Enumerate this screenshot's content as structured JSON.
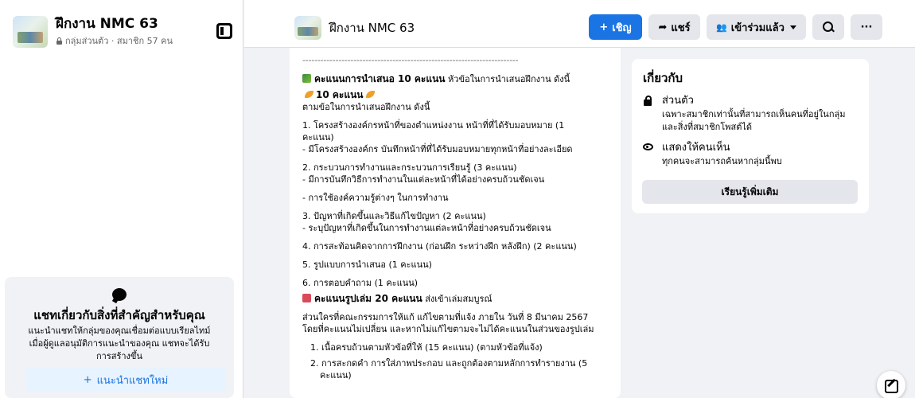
{
  "sidebar": {
    "group_name": "ฝึกงาน NMC 63",
    "group_meta": "กลุ่มส่วนตัว · สมาชิก 57 คน",
    "chat_promo": {
      "title": "แชทเกี่ยวกับสิ่งที่สำคัญสำหรับคุณ",
      "desc_line1": "แนะนำแชทให้กลุ่มของคุณเชื่อมต่อแบบเรียลไทม์",
      "desc_line2": "เมื่อผู้ดูแลอนุมัติการแนะนำของคุณ แชทจะได้รับ",
      "desc_line3": "การสร้างขึ้น",
      "button": "แนะนำแชทใหม่"
    }
  },
  "topbar": {
    "group_name": "ฝึกงาน NMC 63",
    "invite": "เชิญ",
    "share": "แชร์",
    "joined": "เข้าร่วมแล้ว",
    "more": "···"
  },
  "post": {
    "dashes": "------------------------------------------------------------------------",
    "l1_bold": "คะแนนการนำเสนอ 10 คะแนน",
    "l1_rest": " หัวข้อในการนำเสนอฝึกงาน ดังนี้",
    "l2_bold": "10 คะแนน",
    "l3": "ตามข้อในการนำเสนอฝึกงาน ดังนี้",
    "i1a": "1. โครงสร้างองค์กรหน้าที่ของตำแหน่งงาน หน้าที่ที่ได้รับมอบหมาย (1",
    "i1b": "คะแนน)",
    "i1c": "- มีโครงสร้างองค์กร บันทึกหน้าที่ที่ได้รับมอบหมายทุกหน้าที่อย่างละเอียด",
    "i2a": "2. กระบวนการทำงานและกระบวนการเรียนรู้ (3 คะแนน)",
    "i2b": "- มีการบันทึกวิธีการทำงานในแต่ละหน้าที่ได้อย่างครบถ้วนชัดเจน",
    "i2c": "- การใช้องค์ความรู้ต่างๆ ในการทำงาน",
    "i3a": "3. ปัญหาที่เกิดขึ้นและวิธีแก้ไขปัญหา (2 คะแนน)",
    "i3b": "- ระบุปัญหาที่เกิดขึ้นในการทำงานแต่ละหน้าที่อย่างครบถ้วนชัดเจน",
    "i4": "4. การสะท้อนคิดจากการฝึกงาน (ก่อนฝึก ระหว่างฝึก หลังฝึก) (2 คะแนน)",
    "i5": "5. รูปแบบการนำเสนอ (1 คะแนน)",
    "i6": "6. การตอบคำถาม (1 คะแนน)",
    "r_bold": "คะแนนรูปเล่ม 20 คะแนน",
    "r_rest": " ส่งเข้าเล่มสมบูรณ์",
    "r2a": "ส่วนใครที่คณะกรรมการให้แก้ แก้ไขตามที่แจ้ง ภายใน วันที่ 8 มีนาคม 2567",
    "r2b": "โดยที่คะแนนไม่เปลี่ยน และหากไม่แก้ไขตามจะไม่ได้คะแนนในส่วนของรูปเล่ม",
    "n1": "1. เนื้อครบถ้วนตามหัวข้อที่ให้ (15 คะแนน) (ตามหัวข้อที่แจ้ง)",
    "n2a": "2. การสะกดคำ การใส่ภาพประกอบ และถูกต้องตามหลักการทำรายงาน (5",
    "n2b": "คะแนน)"
  },
  "about": {
    "title": "เกี่ยวกับ",
    "private_title": "ส่วนตัว",
    "private_desc1": "เฉพาะสมาชิกเท่านั้นที่สามารถเห็นคนที่อยู่ในกลุ่ม",
    "private_desc2": "และสิ่งที่สมาชิกโพสต์ได้",
    "visible_title": "แสดงให้คนเห็น",
    "visible_desc": "ทุกคนจะสามารถค้นหากลุ่มนี้พบ",
    "learn_more": "เรียนรู้เพิ่มเติม"
  },
  "icons": {
    "plus": "+",
    "share": "➦",
    "people": "👥"
  },
  "colors": {
    "accent": "#1b74e4",
    "bg": "#f0f2f5",
    "button_gray": "#e4e6eb"
  }
}
